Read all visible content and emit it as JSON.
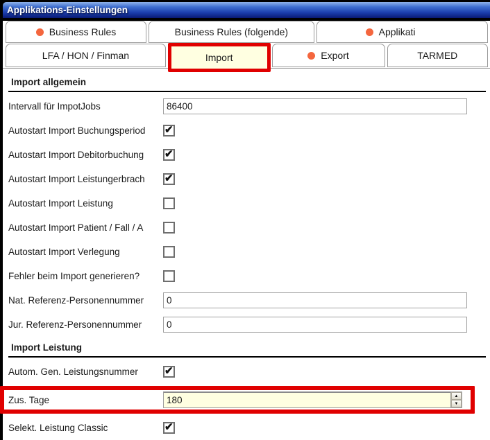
{
  "window": {
    "title": "Applikations-Einstellungen"
  },
  "tabs": {
    "row1": [
      {
        "label": "Business Rules",
        "dot": true
      },
      {
        "label": "Business Rules (folgende)",
        "dot": false
      },
      {
        "label": "Applikati",
        "dot": true
      }
    ],
    "row2": [
      {
        "label": "LFA / HON / Finman",
        "dot": false
      },
      {
        "label": "Import",
        "dot": false,
        "selected": true,
        "highlighted": true
      },
      {
        "label": "Export",
        "dot": true
      },
      {
        "label": "TARMED",
        "dot": false
      }
    ]
  },
  "form": {
    "sections": [
      {
        "title": "Import allgemein",
        "rows": [
          {
            "label": "Intervall für ImpotJobs",
            "type": "text",
            "value": "86400"
          },
          {
            "label": "Autostart Import Buchungsperiod",
            "type": "checkbox",
            "checked": true
          },
          {
            "label": "Autostart Import Debitorbuchung",
            "type": "checkbox",
            "checked": true
          },
          {
            "label": "Autostart Import Leistungerbrach",
            "type": "checkbox",
            "checked": true
          },
          {
            "label": "Autostart Import Leistung",
            "type": "checkbox",
            "checked": false
          },
          {
            "label": "Autostart Import Patient / Fall / A",
            "type": "checkbox",
            "checked": false
          },
          {
            "label": "Autostart Import Verlegung",
            "type": "checkbox",
            "checked": false
          },
          {
            "label": "Fehler beim Import generieren?",
            "type": "checkbox",
            "checked": false
          },
          {
            "label": "Nat. Referenz-Personennummer",
            "type": "text",
            "value": "0"
          },
          {
            "label": "Jur. Referenz-Personennummer",
            "type": "text",
            "value": "0"
          }
        ]
      },
      {
        "title": "Import Leistung",
        "rows": [
          {
            "label": "Autom. Gen. Leistungsnummer",
            "type": "checkbox",
            "checked": true
          },
          {
            "label": "Zus. Tage",
            "type": "spinner",
            "value": "180",
            "highlighted": true
          },
          {
            "label": "Selekt. Leistung Classic",
            "type": "checkbox",
            "checked": true
          }
        ]
      }
    ]
  },
  "icons": {
    "status_dot": "orange-dot-icon",
    "checkmark": "✔",
    "spin_up": "▲",
    "spin_down": "▼"
  },
  "colors": {
    "highlight_red": "#e00000",
    "dot_orange": "#f4663e",
    "selected_tab_bg": "#ffffe1",
    "titlebar_top": "#8fb3ea",
    "titlebar_bottom": "#091a74",
    "tab_border": "#9a9a9a"
  }
}
